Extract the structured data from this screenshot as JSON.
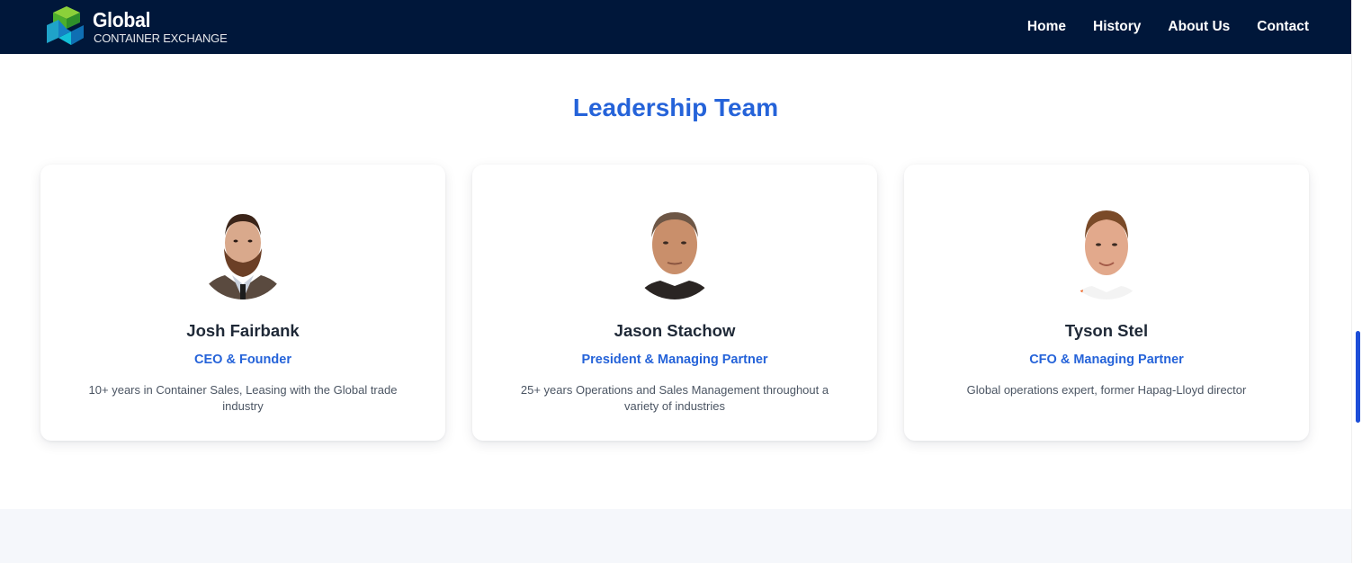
{
  "header": {
    "logo_title": "Global",
    "logo_subtitle": "CONTAINER EXCHANGE",
    "nav": [
      "Home",
      "History",
      "About Us",
      "Contact"
    ]
  },
  "section": {
    "title": "Leadership Team"
  },
  "team": [
    {
      "name": "Josh Fairbank",
      "role": "CEO & Founder",
      "bio": "10+ years in Container Sales, Leasing with the Global trade industry"
    },
    {
      "name": "Jason Stachow",
      "role": "President & Managing Partner",
      "bio": "25+ years Operations and Sales Management throughout a variety of industries"
    },
    {
      "name": "Tyson Stel",
      "role": "CFO & Managing Partner",
      "bio": "Global operations expert, former Hapag-Lloyd director"
    }
  ],
  "colors": {
    "header_bg": "#00173a",
    "accent": "#2563d9",
    "footer_band": "#f5f7fb"
  }
}
